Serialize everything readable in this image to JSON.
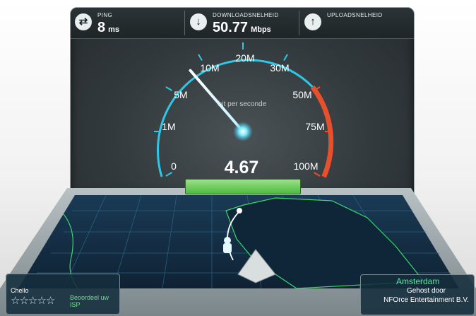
{
  "stats": {
    "ping": {
      "label": "PING",
      "value": "8",
      "unit": "ms",
      "icon": "ping-arrows-icon"
    },
    "download": {
      "label": "DOWNLOADSNELHEID",
      "value": "50.77",
      "unit": "Mbps",
      "icon": "arrow-down-icon"
    },
    "upload": {
      "label": "UPLOADSNELHEID",
      "value": "",
      "unit": "",
      "icon": "arrow-up-icon"
    }
  },
  "gauge": {
    "unit_label": "bit per seconde",
    "current_value": "4.67",
    "needle_fraction": 0.33,
    "ticks": [
      {
        "label": "0"
      },
      {
        "label": "1M"
      },
      {
        "label": "5M"
      },
      {
        "label": "10M"
      },
      {
        "label": "20M"
      },
      {
        "label": "30M"
      },
      {
        "label": "50M"
      },
      {
        "label": "75M"
      },
      {
        "label": "100M"
      }
    ],
    "accent_color": "#2ec8e6",
    "danger_color": "#e8502c"
  },
  "isp": {
    "name": "Chello",
    "rating_stars": 5,
    "rate_label": "Beoordeel uw ISP"
  },
  "server": {
    "city": "Amsterdam",
    "hosted_by": "Gehost door",
    "host": "NFOrce Entertainment B.V."
  }
}
